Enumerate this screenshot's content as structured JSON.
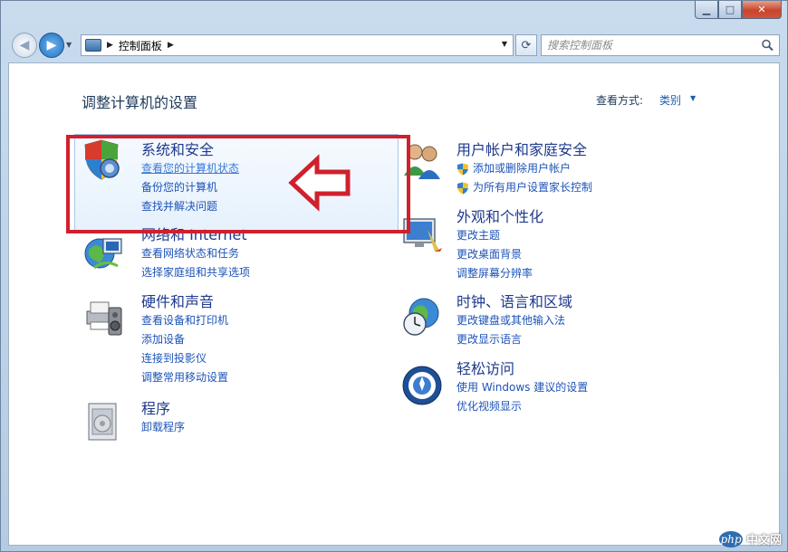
{
  "window": {
    "caption": {
      "minimize": "▁",
      "maximize": "□",
      "close": "✕"
    }
  },
  "nav": {
    "breadcrumb": "控制面板",
    "search_placeholder": "搜索控制面板"
  },
  "content": {
    "title": "调整计算机的设置",
    "view_by_label": "查看方式:",
    "view_by_value": "类别"
  },
  "categories": {
    "system_security": {
      "title": "系统和安全",
      "links": [
        "查看您的计算机状态",
        "备份您的计算机",
        "查找并解决问题"
      ]
    },
    "network": {
      "title": "网络和 Internet",
      "links": [
        "查看网络状态和任务",
        "选择家庭组和共享选项"
      ]
    },
    "hardware": {
      "title": "硬件和声音",
      "links": [
        "查看设备和打印机",
        "添加设备",
        "连接到投影仪",
        "调整常用移动设置"
      ]
    },
    "programs": {
      "title": "程序",
      "links": [
        "卸载程序"
      ]
    },
    "user_accounts": {
      "title": "用户帐户和家庭安全",
      "links": [
        "添加或删除用户帐户",
        "为所有用户设置家长控制"
      ]
    },
    "appearance": {
      "title": "外观和个性化",
      "links": [
        "更改主题",
        "更改桌面背景",
        "调整屏幕分辨率"
      ]
    },
    "clock": {
      "title": "时钟、语言和区域",
      "links": [
        "更改键盘或其他输入法",
        "更改显示语言"
      ]
    },
    "ease": {
      "title": "轻松访问",
      "links": [
        "使用 Windows 建议的设置",
        "优化视频显示"
      ]
    }
  },
  "watermark": {
    "logo": "php",
    "text": "中文网"
  },
  "colors": {
    "accent_red": "#d0202d",
    "link_blue": "#1d53b8",
    "title_blue": "#1f3a8c"
  }
}
